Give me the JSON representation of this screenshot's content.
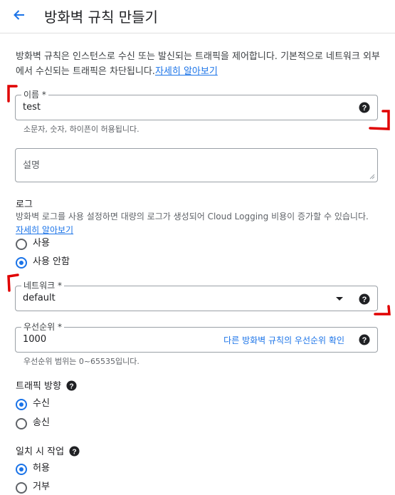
{
  "header": {
    "title": "방화벽 규칙 만들기"
  },
  "intro": {
    "text": "방화벽 규칙은 인스턴스로 수신 또는 발신되는 트래픽을 제어합니다. 기본적으로 네트워크 외부에서 수신되는 트래픽은 차단됩니다.",
    "link": "자세히 알아보기"
  },
  "name_field": {
    "label": "이름 *",
    "value": "test",
    "hint": "소문자, 숫자, 하이픈이 허용됩니다."
  },
  "description_field": {
    "placeholder": "설명"
  },
  "logs": {
    "title": "로그",
    "text": "방화벽 로그를 사용 설정하면 대량의 로그가 생성되어 Cloud Logging 비용이 증가할 수 있습니다.",
    "link": "자세히 알아보기",
    "options": [
      {
        "label": "사용",
        "checked": false
      },
      {
        "label": "사용 안함",
        "checked": true
      }
    ]
  },
  "network_field": {
    "label": "네트워크 *",
    "value": "default"
  },
  "priority_field": {
    "label": "우선순위 *",
    "value": "1000",
    "link": "다른 방화벽 규칙의 우선순위 확인",
    "hint": "우선순위 범위는 0~65535입니다."
  },
  "direction": {
    "title": "트래픽 방향",
    "options": [
      {
        "label": "수신",
        "checked": true
      },
      {
        "label": "송신",
        "checked": false
      }
    ]
  },
  "action": {
    "title": "일치 시 작업",
    "options": [
      {
        "label": "허용",
        "checked": true
      },
      {
        "label": "거부",
        "checked": false
      }
    ]
  },
  "colors": {
    "accent": "#1a73e8",
    "annotation": "#e00000"
  }
}
